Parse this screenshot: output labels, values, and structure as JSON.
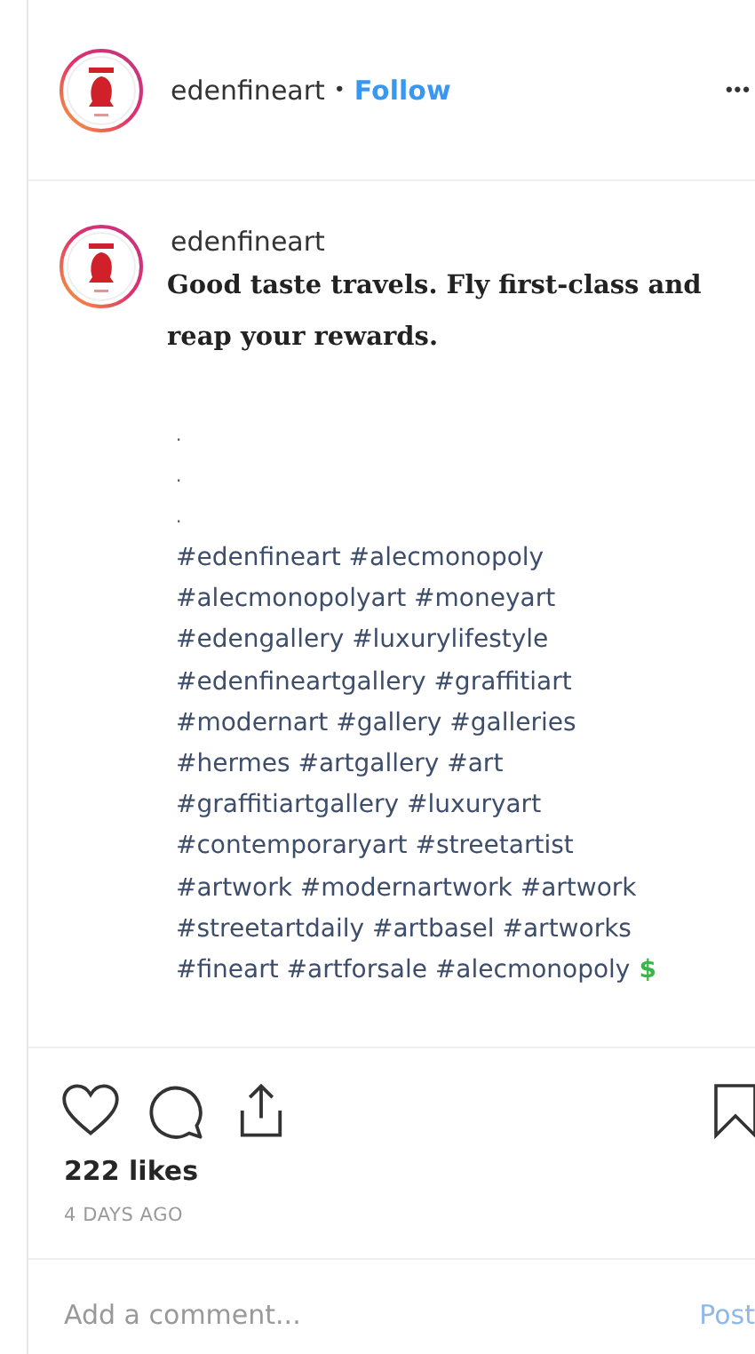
{
  "header": {
    "username": "edenfineart",
    "separator": "•",
    "follow": "Follow",
    "more": "•••"
  },
  "caption": {
    "username": "edenfineart",
    "text": "Good taste travels. Fly first-class and reap your rewards.",
    "dots": [
      ".",
      ".",
      "."
    ],
    "hashtag_lines": [
      "#edenfineart #alecmonopoly",
      "#alecmonopolyart #moneyart",
      "#edengallery #luxurylifestyle",
      "#edenfineartgallery #graffitiart",
      "#modernart #gallery #galleries",
      "#hermes #artgallery #art",
      "#graffitiartgallery #luxuryart",
      "#contemporaryart #streetartist",
      "#artwork #modernartwork #artwork",
      "#streetartdaily #artbasel #artworks",
      "#fineart #artforsale #alecmonopoly"
    ],
    "emoji": "$"
  },
  "actions": {
    "liked": false,
    "saved": false
  },
  "likes": "222 likes",
  "time": "4 DAYS AGO",
  "comment": {
    "placeholder": "Add a comment...",
    "post": "Post",
    "post_disabled": true
  }
}
